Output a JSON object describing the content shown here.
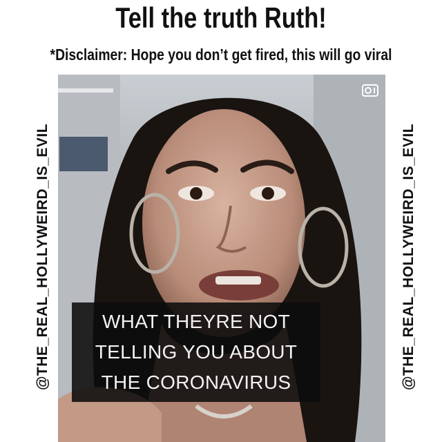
{
  "header": {
    "title": "Tell the truth Ruth!",
    "disclaimer": "*Disclaimer: Hope you don’t get fired, this will go viral"
  },
  "watermarks": {
    "left": "@THE_REAL_HOLLYWEIRD_IS_EVIL",
    "right": "@THE_REAL_HOLLYWEIRD_IS_EVIL"
  },
  "video": {
    "caption_lines": [
      "WHAT THEYRE NOT",
      "TELLING YOU ABOUT",
      "THE CORONAVIRUS"
    ],
    "icon": "igtv-icon"
  }
}
